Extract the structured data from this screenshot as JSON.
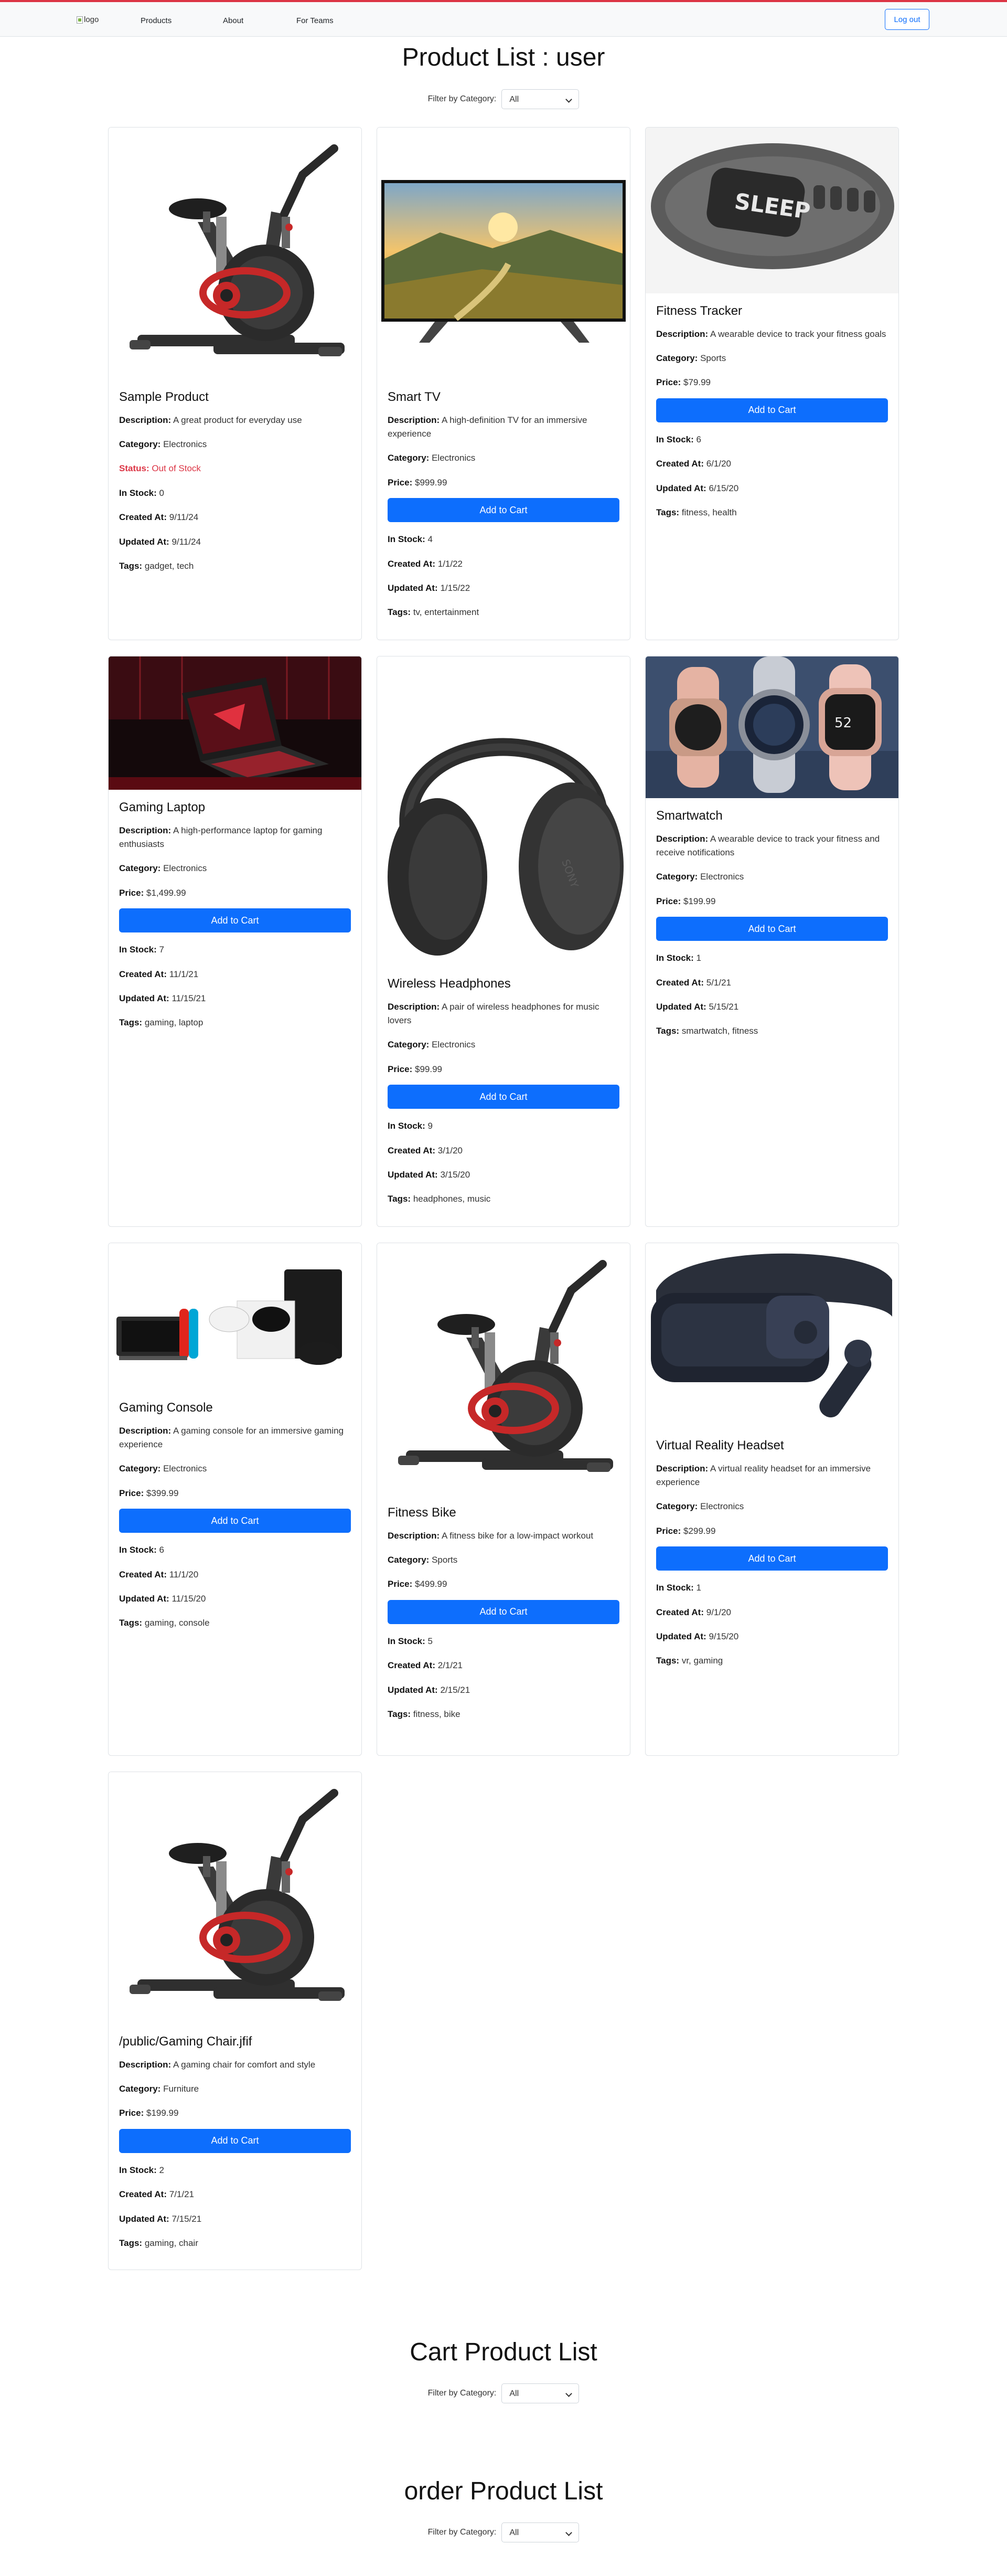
{
  "nav": {
    "logo_alt": "logo",
    "links": [
      "Products",
      "About",
      "For Teams"
    ],
    "logout_label": "Log out"
  },
  "product_section": {
    "title": "Product List : user",
    "filter_label": "Filter by Category:",
    "filter_value": "All"
  },
  "cart_section": {
    "title": "Cart Product List",
    "filter_label": "Filter by Category:",
    "filter_value": "All"
  },
  "order_section": {
    "title": "order Product List",
    "filter_label": "Filter by Category:",
    "filter_value": "All"
  },
  "labels": {
    "description": "Description:",
    "category": "Category:",
    "price": "Price:",
    "status": "Status:",
    "in_stock": "In Stock:",
    "created_at": "Created At:",
    "updated_at": "Updated At:",
    "tags": "Tags:",
    "add_to_cart": "Add to Cart"
  },
  "products": [
    {
      "name": "Sample Product",
      "description": "A great product for everyday use",
      "category": "Electronics",
      "status": "Out of Stock",
      "in_stock": "0",
      "created_at": "9/11/24",
      "updated_at": "9/11/24",
      "tags": "gadget, tech",
      "image": "exercise-bike"
    },
    {
      "name": "Smart TV",
      "description": "A high-definition TV for an immersive experience",
      "category": "Electronics",
      "price": "$999.99",
      "in_stock": "4",
      "created_at": "1/1/22",
      "updated_at": "1/15/22",
      "tags": "tv, entertainment",
      "image": "smart-tv"
    },
    {
      "name": "Fitness Tracker",
      "description": "A wearable device to track your fitness goals",
      "category": "Sports",
      "price": "$79.99",
      "in_stock": "6",
      "created_at": "6/1/20",
      "updated_at": "6/15/20",
      "tags": "fitness, health",
      "image": "fitness-band",
      "band_text": "SLEEP"
    },
    {
      "name": "Gaming Laptop",
      "description": "A high-performance laptop for gaming enthusiasts",
      "category": "Electronics",
      "price": "$1,499.99",
      "in_stock": "7",
      "created_at": "11/1/21",
      "updated_at": "11/15/21",
      "tags": "gaming, laptop",
      "image": "gaming-laptop"
    },
    {
      "name": "Wireless Headphones",
      "description": "A pair of wireless headphones for music lovers",
      "category": "Electronics",
      "price": "$99.99",
      "in_stock": "9",
      "created_at": "3/1/20",
      "updated_at": "3/15/20",
      "tags": "headphones, music",
      "image": "headphones"
    },
    {
      "name": "Smartwatch",
      "description": "A wearable device to track your fitness and receive notifications",
      "category": "Electronics",
      "price": "$199.99",
      "in_stock": "1",
      "created_at": "5/1/21",
      "updated_at": "5/15/21",
      "tags": "smartwatch, fitness",
      "image": "smartwatches"
    },
    {
      "name": "Gaming Console",
      "description": "A gaming console for an immersive gaming experience",
      "category": "Electronics",
      "price": "$399.99",
      "in_stock": "6",
      "created_at": "11/1/20",
      "updated_at": "11/15/20",
      "tags": "gaming, console",
      "image": "game-consoles"
    },
    {
      "name": "Fitness Bike",
      "description": "A fitness bike for a low-impact workout",
      "category": "Sports",
      "price": "$499.99",
      "in_stock": "5",
      "created_at": "2/1/21",
      "updated_at": "2/15/21",
      "tags": "fitness, bike",
      "image": "exercise-bike"
    },
    {
      "name": "Virtual Reality Headset",
      "description": "A virtual reality headset for an immersive experience",
      "category": "Electronics",
      "price": "$299.99",
      "in_stock": "1",
      "created_at": "9/1/20",
      "updated_at": "9/15/20",
      "tags": "vr, gaming",
      "image": "vr-headset"
    },
    {
      "name": "/public/Gaming Chair.jfif",
      "description": "A gaming chair for comfort and style",
      "category": "Furniture",
      "price": "$199.99",
      "in_stock": "2",
      "created_at": "7/1/21",
      "updated_at": "7/15/21",
      "tags": "gaming, chair",
      "image": "exercise-bike"
    }
  ]
}
